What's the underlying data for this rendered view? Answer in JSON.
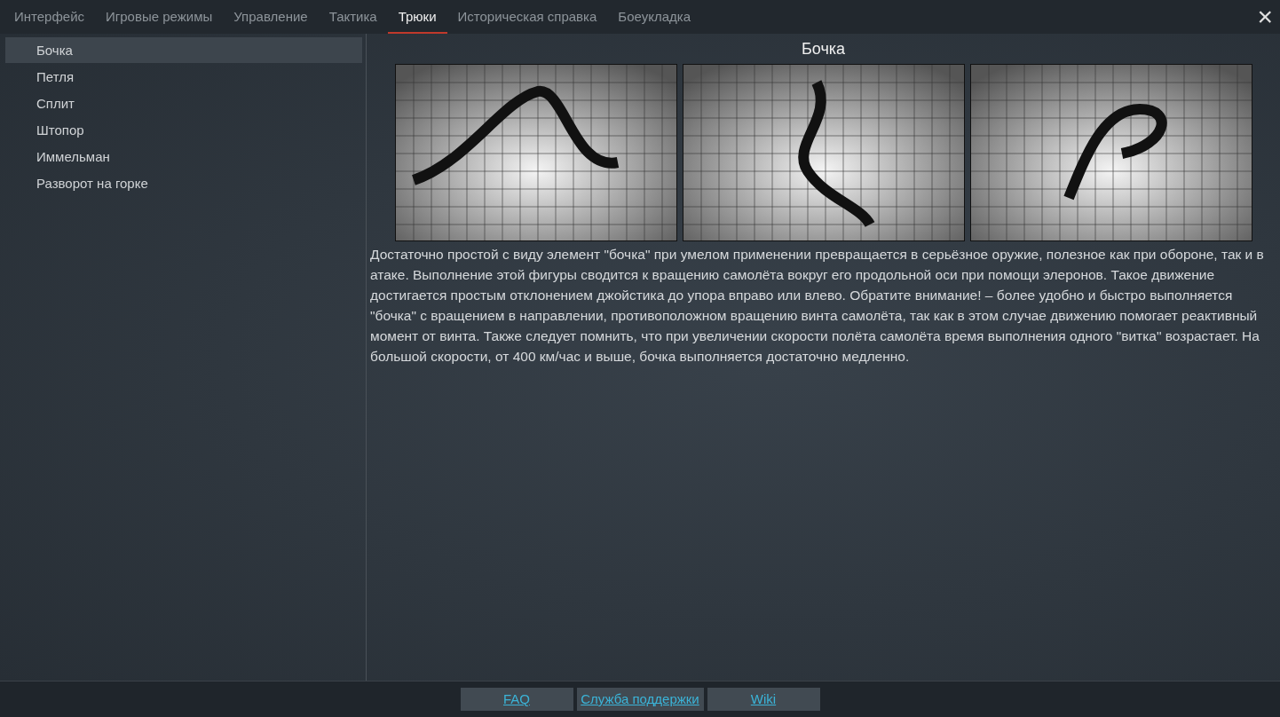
{
  "tabs": [
    {
      "label": "Интерфейс",
      "selected": false
    },
    {
      "label": "Игровые режимы",
      "selected": false
    },
    {
      "label": "Управление",
      "selected": false
    },
    {
      "label": "Тактика",
      "selected": false
    },
    {
      "label": "Трюки",
      "selected": true
    },
    {
      "label": "Историческая справка",
      "selected": false
    },
    {
      "label": "Боеукладка",
      "selected": false
    }
  ],
  "close": "×",
  "sidebar": {
    "items": [
      {
        "label": "Бочка",
        "selected": true
      },
      {
        "label": "Петля",
        "selected": false
      },
      {
        "label": "Сплит",
        "selected": false
      },
      {
        "label": "Штопор",
        "selected": false
      },
      {
        "label": "Иммельман",
        "selected": false
      },
      {
        "label": "Разворот на горке",
        "selected": false
      }
    ]
  },
  "article": {
    "title": "Бочка",
    "text": "Достаточно простой с виду элемент \"бочка\" при умелом применении превращается в серьёзное оружие, полезное как при обороне, так и в атаке. Выполнение этой фигуры сводится к вращению самолёта вокруг его продольной оси при помощи элеронов. Такое движение достигается простым отклонением джойстика до упора вправо или влево. Обратите внимание! – более удобно и быстро выполняется \"бочка\" с вращением в направлении, противоположном вращению винта самолёта, так как в этом случае движению помогает реактивный момент от винта. Также следует помнить, что при увеличении скорости полёта самолёта время выполнения одного \"витка\" возрастает. На большой скорости, от 400 км/час и выше, бочка выполняется достаточно медленно."
  },
  "footer_links": [
    "FAQ",
    "Служба поддержки",
    "Wiki"
  ]
}
